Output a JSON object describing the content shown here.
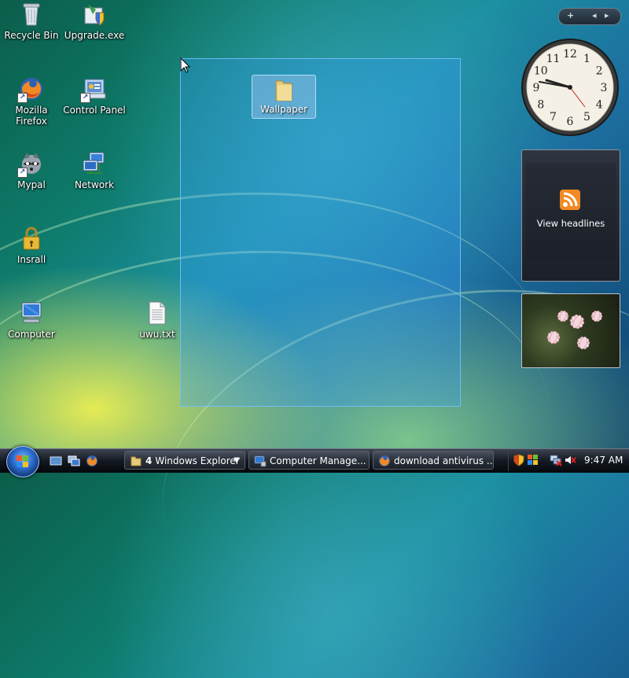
{
  "desktop": {
    "icons": [
      {
        "label": "Recycle Bin"
      },
      {
        "label": "Upgrade.exe"
      },
      {
        "label": "Mozilla Firefox"
      },
      {
        "label": "Control Panel"
      },
      {
        "label": "Mypal"
      },
      {
        "label": "Network"
      },
      {
        "label": "Insrall"
      },
      {
        "label": "Computer"
      },
      {
        "label": "uwu.txt"
      }
    ],
    "selected_item": {
      "label": "Wallpaper"
    }
  },
  "sidebar": {
    "feed_gadget_text": "View headlines",
    "control": {
      "add": "+",
      "prev": "◂",
      "next": "▸"
    },
    "clock_numbers": [
      "12",
      "1",
      "2",
      "3",
      "4",
      "5",
      "6",
      "7",
      "8",
      "9",
      "10",
      "11"
    ]
  },
  "taskbar": {
    "buttons": [
      {
        "count": "4",
        "label": "Windows Explorer"
      },
      {
        "label": "Computer Manage..."
      },
      {
        "label": "download antivirus ..."
      }
    ],
    "time": "9:47 AM"
  },
  "colors": {
    "selection": "#3399ff",
    "rss": "#f08a24",
    "taskbar": "#141920"
  }
}
